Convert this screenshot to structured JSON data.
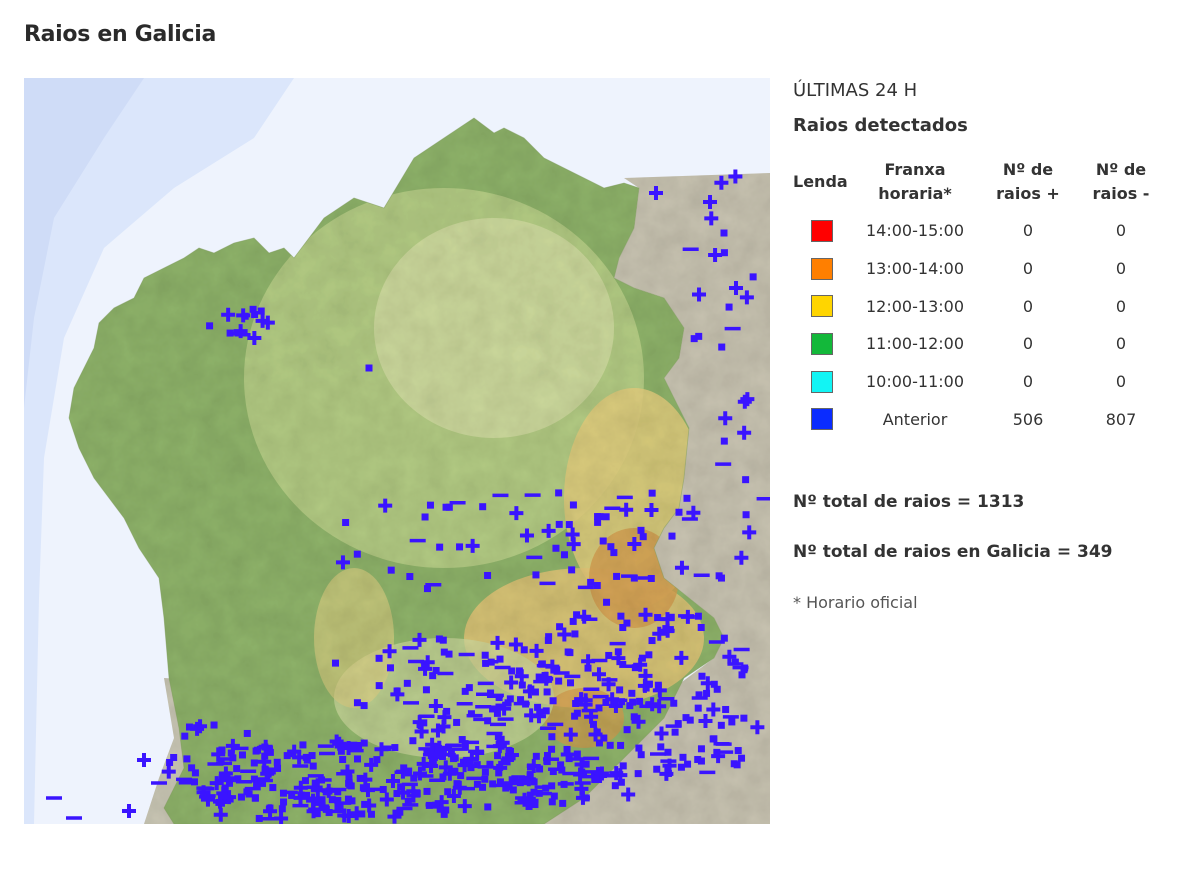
{
  "title": "Raios en Galicia",
  "panel": {
    "period": "ÚLTIMAS 24 H",
    "subtitle": "Raios detectados",
    "headers": {
      "legend": "Lenda",
      "range_line1": "Franxa",
      "range_line2": "horaria*",
      "pos_line1": "Nº de",
      "pos_line2": "raios +",
      "neg_line1": "Nº de",
      "neg_line2": "raios -"
    },
    "rows": [
      {
        "color": "#ff0000",
        "range": "14:00-15:00",
        "pos": "0",
        "neg": "0"
      },
      {
        "color": "#ff7f00",
        "range": "13:00-14:00",
        "pos": "0",
        "neg": "0"
      },
      {
        "color": "#ffd500",
        "range": "12:00-13:00",
        "pos": "0",
        "neg": "0"
      },
      {
        "color": "#13b83a",
        "range": "11:00-12:00",
        "pos": "0",
        "neg": "0"
      },
      {
        "color": "#12f4f4",
        "range": "10:00-11:00",
        "pos": "0",
        "neg": "0"
      },
      {
        "color": "#0a2cff",
        "range": "Anterior",
        "pos": "506",
        "neg": "807"
      }
    ],
    "total": "Nº total de raios = 1313",
    "total_galicia": "Nº total de raios en Galicia = 349",
    "note": "* Horario oficial"
  },
  "map": {
    "strike_color": "#3a14ff",
    "sea_color": "#eef3fd",
    "land_green": "#8fb36a",
    "land_light": "#cfd99a",
    "land_yellow": "#e3cf7a",
    "land_orange": "#d9a24f",
    "outside_gray": "#c9c6b6"
  }
}
